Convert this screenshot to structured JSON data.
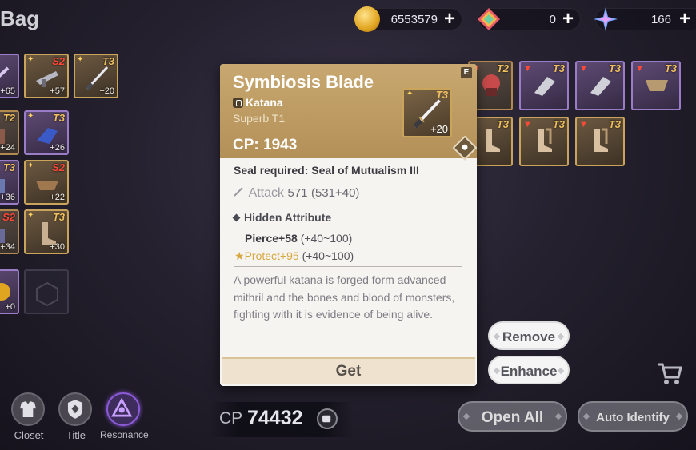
{
  "header": {
    "title": "Bag",
    "currencies": [
      {
        "icon": "gold-coin-icon",
        "value": "6553579"
      },
      {
        "icon": "crystal-icon",
        "value": "0"
      },
      {
        "icon": "star-gem-icon",
        "value": "166"
      }
    ]
  },
  "inventory_left": [
    {
      "tier": "",
      "plus": "+65"
    },
    {
      "tier": "S2",
      "plus": "+57"
    },
    {
      "tier": "T3",
      "plus": "+20"
    },
    {
      "tier": "T2",
      "plus": "+24"
    },
    {
      "tier": "T3",
      "plus": "+26"
    },
    {
      "tier": "T3",
      "plus": "+36"
    },
    {
      "tier": "S2",
      "plus": "+22"
    },
    {
      "tier": "S2",
      "plus": "+34"
    },
    {
      "tier": "T3",
      "plus": "+30"
    },
    {
      "tier": "",
      "plus": "+0"
    }
  ],
  "inventory_right": [
    {
      "tier": "T2"
    },
    {
      "tier": "T3"
    },
    {
      "tier": "T3"
    },
    {
      "tier": "T3"
    },
    {
      "tier": "T3"
    },
    {
      "tier": "T3"
    },
    {
      "tier": "T3"
    }
  ],
  "tooltip": {
    "name": "Symbiosis Blade",
    "type": "Katana",
    "grade": "Superb T1",
    "cp": "CP: 1943",
    "badge": "E",
    "thumb_tier": "T3",
    "thumb_plus": "+20",
    "seal": "Seal required: Seal of Mutualism III",
    "attack_label": "Attack",
    "attack_value": "571",
    "attack_breakdown": "(531+40)",
    "hidden_title": "Hidden Attribute",
    "pierce": "Pierce+58",
    "pierce_range": "(+40~100)",
    "protect": "Protect+95",
    "protect_range": "(+40~100)",
    "description": "A powerful katana is forged form advanced mithril and the bones and blood of monsters, fighting with it is evidence of being alive.",
    "get_label": "Get"
  },
  "actions": {
    "remove": "Remove",
    "enhance": "Enhance",
    "open_all": "Open All",
    "auto_identify": "Auto Identify"
  },
  "bottom_nav": [
    {
      "label": "Closet",
      "icon": "closet-icon"
    },
    {
      "label": "Title",
      "icon": "title-icon"
    },
    {
      "label": "Resonance",
      "icon": "resonance-icon"
    }
  ],
  "cp_total": {
    "label": "CP",
    "value": "74432"
  },
  "colors": {
    "card_header": "#c8a870",
    "tier_gold": "#f0c060",
    "tier_red": "#ff4a3a",
    "protect_gold": "#d8a840",
    "resonance_purple": "#8c5ad8"
  }
}
